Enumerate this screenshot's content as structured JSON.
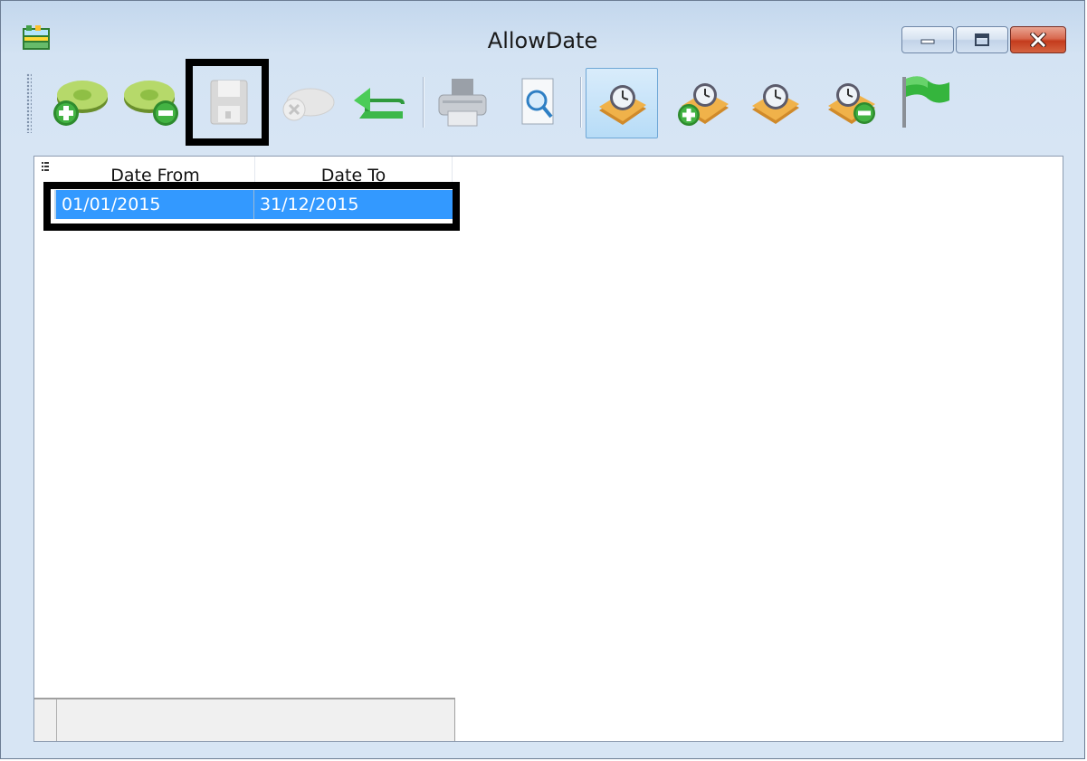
{
  "window": {
    "title": "AllowDate"
  },
  "caption_buttons": {
    "minimize_icon": "minimize-icon",
    "maximize_icon": "maximize-icon",
    "close_icon": "close-icon"
  },
  "toolbar": {
    "buttons": [
      {
        "icon": "add-money-icon",
        "state": "enabled"
      },
      {
        "icon": "remove-money-icon",
        "state": "enabled"
      },
      {
        "icon": "save-disk-icon",
        "state": "disabled",
        "highlighted": true
      },
      {
        "icon": "cancel-icon",
        "state": "disabled"
      },
      {
        "icon": "undo-arrow-icon",
        "state": "enabled"
      },
      {
        "icon": "printer-icon",
        "state": "enabled"
      },
      {
        "icon": "print-preview-icon",
        "state": "enabled"
      },
      {
        "icon": "clock-icon",
        "state": "pressed"
      },
      {
        "icon": "clock-add-icon",
        "state": "enabled"
      },
      {
        "icon": "clock-edit-icon",
        "state": "enabled"
      },
      {
        "icon": "clock-remove-icon",
        "state": "enabled"
      },
      {
        "icon": "green-flag-icon",
        "state": "enabled"
      }
    ]
  },
  "grid": {
    "columns": [
      "Date From",
      "Date To"
    ],
    "rows": [
      {
        "date_from": "01/01/2015",
        "date_to": "31/12/2015",
        "selected": true
      }
    ]
  },
  "colors": {
    "selection": "#3399ff",
    "window_bg": "#d7e5f4",
    "highlight_border": "#000000"
  }
}
